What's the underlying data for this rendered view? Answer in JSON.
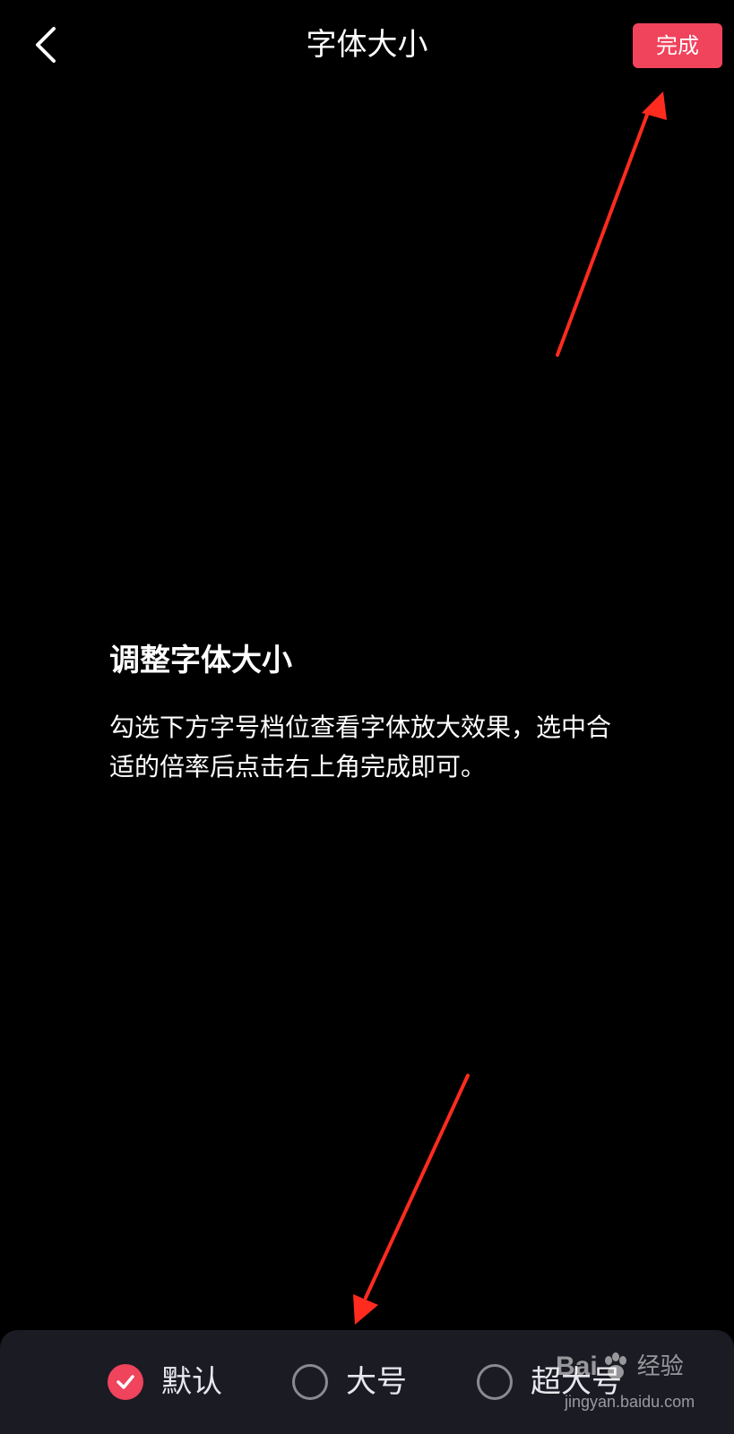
{
  "colors": {
    "background": "#000000",
    "accent": "#f0435c",
    "panel": "#1b1b24",
    "annotation_arrow": "#ff2b1f"
  },
  "header": {
    "back_icon": "chevron-left-icon",
    "title": "字体大小",
    "done_label": "完成"
  },
  "content": {
    "heading": "调整字体大小",
    "description": "勾选下方字号档位查看字体放大效果，选中合适的倍率后点击右上角完成即可。"
  },
  "font_size_options": {
    "selected_index": 0,
    "items": [
      {
        "label": "默认",
        "icon": "check-icon",
        "checked": true
      },
      {
        "label": "大号",
        "icon": "radio-icon",
        "checked": false
      },
      {
        "label": "超大号",
        "icon": "radio-icon",
        "checked": false
      }
    ]
  },
  "watermark": {
    "logo_prefix": "Bai",
    "logo_icon": "paw-icon",
    "logo_suffix": "经验",
    "url": "jingyan.baidu.com"
  }
}
